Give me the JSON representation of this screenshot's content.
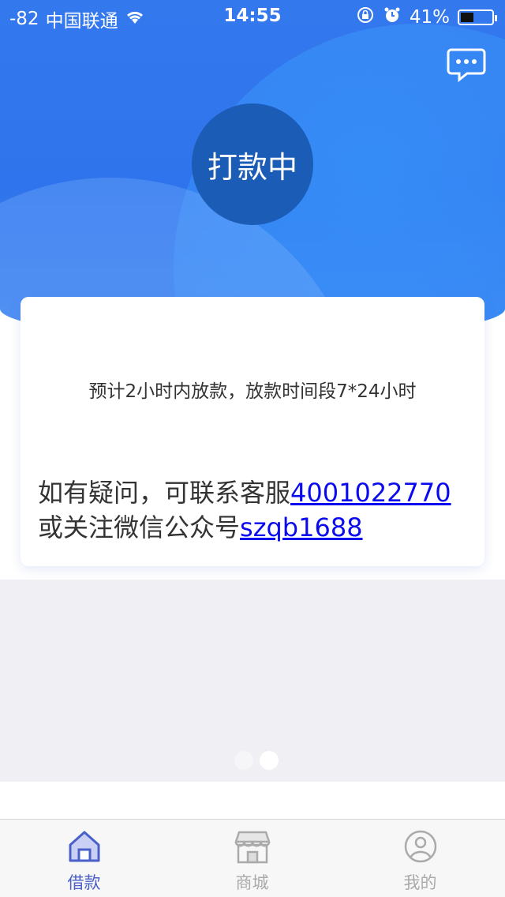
{
  "status_bar": {
    "signal": "-82",
    "carrier": "中国联通",
    "time": "14:55",
    "battery": "41%"
  },
  "hero": {
    "status_label": "打款中"
  },
  "card": {
    "note": "预计2小时内放款，放款时间段7*24小时",
    "contact_prefix": "如有疑问，可联系客服",
    "phone": "4001022770",
    "wechat_prefix": "或关注微信公众号",
    "wechat_id": "szqb1688"
  },
  "pager": {
    "count": 2,
    "active": 1
  },
  "tabs": [
    {
      "label": "借款",
      "icon": "home-icon",
      "active": true
    },
    {
      "label": "商城",
      "icon": "store-icon",
      "active": false
    },
    {
      "label": "我的",
      "icon": "profile-icon",
      "active": false
    }
  ],
  "colors": {
    "primary": "#2f74ec",
    "circle": "#1a5cb6",
    "link": "#0a0aee",
    "tab_active": "#4a5fc9",
    "tab_inactive": "#aaaaaa"
  }
}
